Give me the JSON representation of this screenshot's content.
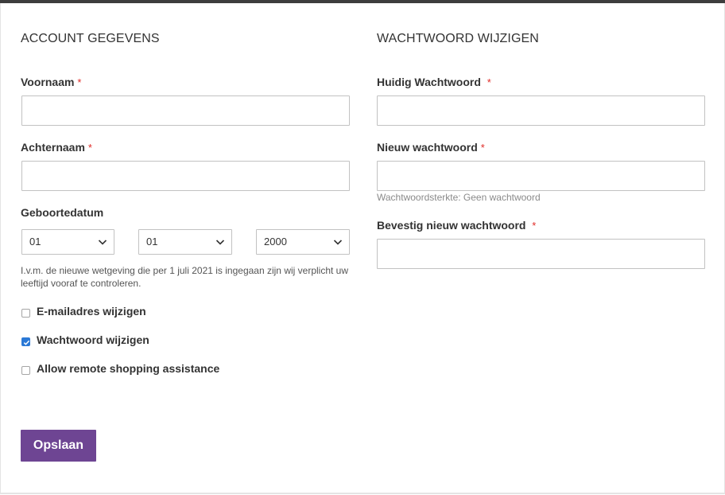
{
  "account": {
    "title": "ACCOUNT GEGEVENS",
    "firstname": {
      "label": "Voornaam",
      "required_mark": "*",
      "value": ""
    },
    "lastname": {
      "label": "Achternaam",
      "required_mark": "*",
      "value": ""
    },
    "dob": {
      "label": "Geboortedatum",
      "day": "01",
      "month": "01",
      "year": "2000",
      "icon": "chevron-down-icon"
    },
    "age_note": "I.v.m. de nieuwe wetgeving die per 1 juli 2021 is ingegaan zijn wij verplicht uw leeftijd vooraf te controleren.",
    "checkboxes": [
      {
        "label": "E-mailadres wijzigen",
        "checked": false
      },
      {
        "label": "Wachtwoord wijzigen",
        "checked": true
      },
      {
        "label": "Allow remote shopping assistance",
        "checked": false
      }
    ],
    "save_label": "Opslaan"
  },
  "password": {
    "title": "WACHTWOORD WIJZIGEN",
    "current": {
      "label": "Huidig Wachtwoord",
      "required_mark": "*",
      "value": ""
    },
    "new": {
      "label": "Nieuw wachtwoord",
      "required_mark": "*",
      "value": ""
    },
    "strength": "Wachtwoordsterkte: Geen wachtwoord",
    "confirm": {
      "label": "Bevestig nieuw wachtwoord",
      "required_mark": "*",
      "value": ""
    }
  },
  "colors": {
    "accent": "#6e4593",
    "required": "#e02b27",
    "checkbox_checked": "#2b79d6",
    "top_bar": "#3d3d3d"
  }
}
